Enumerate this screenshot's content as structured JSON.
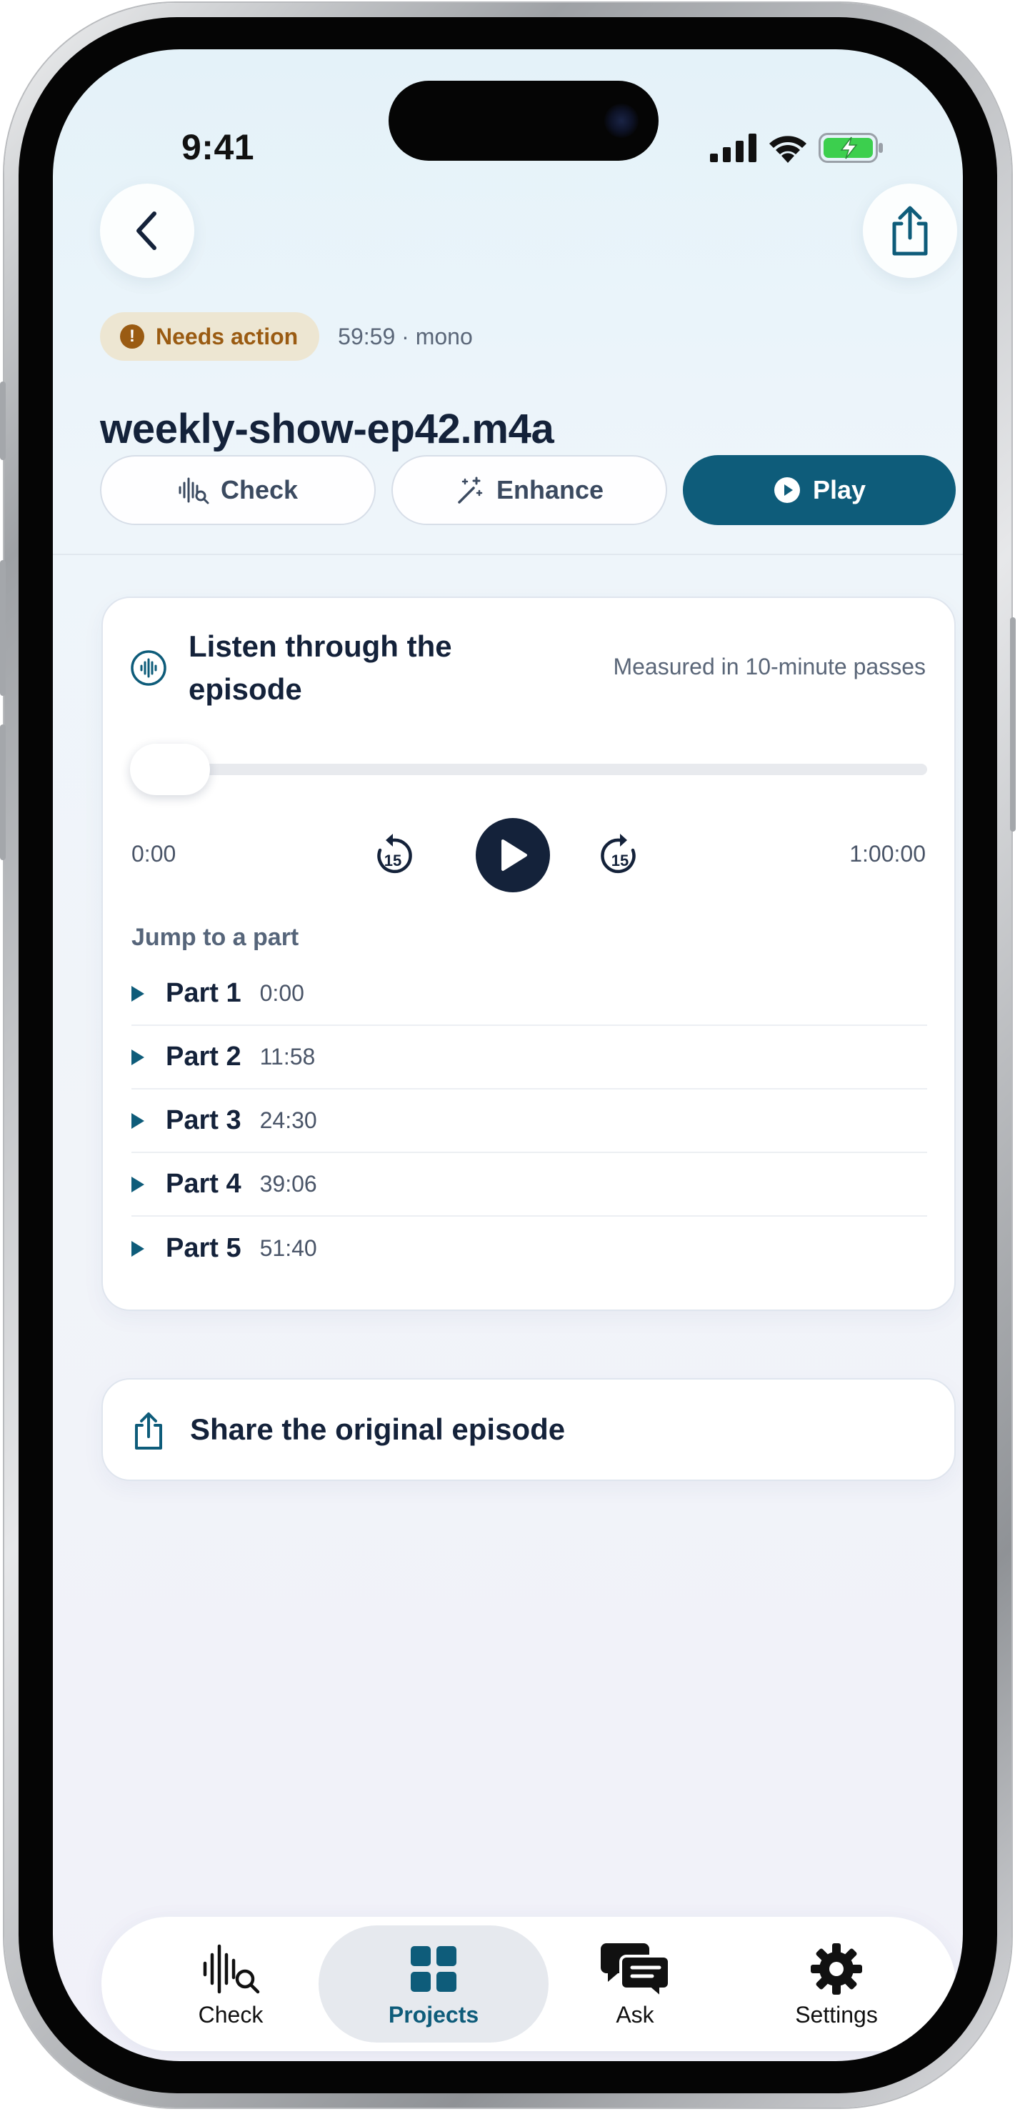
{
  "status_bar": {
    "time": "9:41"
  },
  "header": {
    "badge": {
      "icon": "exclamation-icon",
      "symbol": "!",
      "label": "Needs action"
    },
    "meta": "59:59 · mono",
    "file_name": "weekly-show-ep42.m4a"
  },
  "actions": {
    "check_label": "Check",
    "enhance_label": "Enhance",
    "play_label": "Play"
  },
  "listen": {
    "title": "Listen through the episode",
    "note": "Measured in 10-minute passes",
    "progress": 0,
    "time_current": "0:00",
    "time_total": "1:00:00",
    "skip_back_label": "15",
    "skip_forward_label": "15",
    "jump_label": "Jump to a part",
    "parts": [
      {
        "name": "Part 1",
        "time": "0:00"
      },
      {
        "name": "Part 2",
        "time": "11:58"
      },
      {
        "name": "Part 3",
        "time": "24:30"
      },
      {
        "name": "Part 4",
        "time": "39:06"
      },
      {
        "name": "Part 5",
        "time": "51:40"
      }
    ]
  },
  "share": {
    "label": "Share the original episode"
  },
  "tabbar": {
    "tabs": [
      {
        "label": "Check",
        "icon": "waveform-search-icon",
        "active": false
      },
      {
        "label": "Projects",
        "icon": "grid-icon",
        "active": true
      },
      {
        "label": "Ask",
        "icon": "chat-bubbles-icon",
        "active": false
      },
      {
        "label": "Settings",
        "icon": "gear-icon",
        "active": false
      }
    ]
  },
  "colors": {
    "accent": "#0e5c7a",
    "badge_bg": "#ede6d2",
    "badge_text": "#9a5b12",
    "navy": "#14223a"
  }
}
